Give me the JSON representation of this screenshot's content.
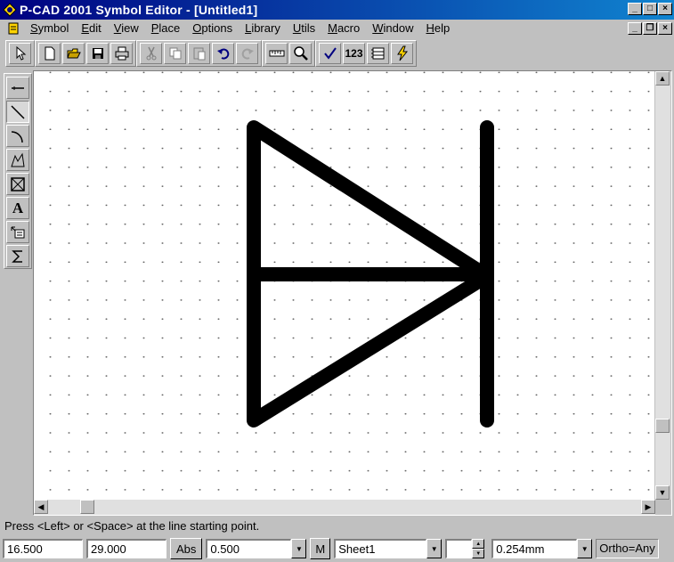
{
  "window": {
    "title": "P-CAD 2001 Symbol Editor - [Untitled1]",
    "icon": "pcad-app-icon"
  },
  "menu": [
    {
      "label": "Symbol",
      "access": "S"
    },
    {
      "label": "Edit",
      "access": "E"
    },
    {
      "label": "View",
      "access": "V"
    },
    {
      "label": "Place",
      "access": "P"
    },
    {
      "label": "Options",
      "access": "O"
    },
    {
      "label": "Library",
      "access": "L"
    },
    {
      "label": "Utils",
      "access": "U"
    },
    {
      "label": "Macro",
      "access": "M"
    },
    {
      "label": "Window",
      "access": "W"
    },
    {
      "label": "Help",
      "access": "H"
    }
  ],
  "toolbar": {
    "buttons": [
      "select-icon",
      "new-icon",
      "open-icon",
      "save-icon",
      "print-icon",
      "cut-icon",
      "copy-icon",
      "paste-icon",
      "undo-icon",
      "redo-icon",
      "measure-icon",
      "zoom-icon",
      "check-icon",
      "renumber-icon",
      "symbol-wizard-icon",
      "flash-icon"
    ],
    "renumber_label": "123"
  },
  "palette": {
    "tools": [
      "pin-tool-icon",
      "line-tool-icon",
      "arc-tool-icon",
      "polygon-tool-icon",
      "ref-point-icon",
      "text-tool-icon",
      "attribute-tool-icon",
      "ieee-symbol-icon"
    ],
    "active": "line-tool-icon",
    "text_tool_label": "A"
  },
  "canvas": {
    "symbol": "diode"
  },
  "status": {
    "prompt": "Press <Left> or <Space> at the line starting point.",
    "x": "16.500",
    "y": "29.000",
    "abs_label": "Abs",
    "grid": "0.500",
    "m_label": "M",
    "sheet": "Sheet1",
    "line_width": "0.254mm",
    "ortho": "Ortho=Any"
  }
}
